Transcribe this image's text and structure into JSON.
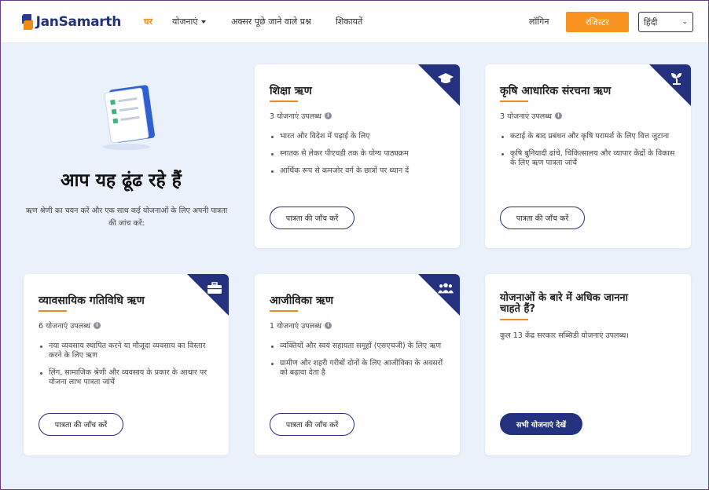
{
  "header": {
    "logo_text": "JanSamarth",
    "nav": [
      {
        "label": "घर",
        "active": true
      },
      {
        "label": "योजनाएं",
        "has_caret": true
      },
      {
        "label": "अक्सर पूछे जाने वाले प्रश्न"
      },
      {
        "label": "शिकायतें"
      }
    ],
    "login_label": "लॉगिन",
    "register_label": "रजिस्टर",
    "language": "हिंदी",
    "accent_color": "#f7931e",
    "brand_color": "#24317e"
  },
  "intro": {
    "title": "आप यह ढूंढ रहे हैं",
    "subtitle": "ऋण श्रेणी का चयन करें और एक साथ कई योजनाओं के लिए अपनी पात्रता की जांच करें:"
  },
  "cards": [
    {
      "title": "शिक्षा ऋण",
      "count": "3 योजनाएं उपलब्ध",
      "icon": "graduation-cap-icon",
      "bullets": [
        "भारत और विदेश में पढ़ाई के लिए",
        "स्नातक से लेकर पीएचडी तक के योग्य पाठ्यक्रम",
        "आर्थिक रूप से कमजोर वर्ग के छात्रों पर ध्यान दें"
      ],
      "button": "पात्रता की जाँच करें"
    },
    {
      "title": "कृषि आधारिक संरचना ऋण",
      "count": "3 योजनाएं उपलब्ध",
      "icon": "sprout-icon",
      "bullets": [
        "कटाई के बाद प्रबंधन और कृषि परामर्श के लिए वित्त जुटाना",
        "कृषि बुनियादी ढांचे, चिकित्सालय और व्यापार केंद्रों के विकास के लिए ऋण पात्रता जांचें"
      ],
      "button": "पात्रता की जाँच करें"
    },
    {
      "title": "व्यावसायिक गतिविधि ऋण",
      "count": "6 योजनाएं उपलब्ध",
      "icon": "briefcase-icon",
      "bullets": [
        "नया व्यवसाय स्थापित करने या मौजूदा व्यवसाय का विस्तार करने के लिए ऋण",
        "लिंग, सामाजिक श्रेणी और व्यवसाय के प्रकार के आधार पर योजना लाभ पात्रता जांचें"
      ],
      "button": "पात्रता की जाँच करें"
    },
    {
      "title": "आजीविका ऋण",
      "count": "1 योजनाएं उपलब्ध",
      "icon": "people-icon",
      "bullets": [
        "व्यक्तियों और स्वयं सहायता समूहों (एसएचजी) के लिए ऋण",
        "ग्रामीण और शहरी गरीबों दोनों के लिए आजीविका के अवसरों को बढ़ावा देता है"
      ],
      "button": "पात्रता की जाँच करें"
    }
  ],
  "more": {
    "title": "योजनाओं के बारे में अधिक जानना चाहते हैं?",
    "subtitle": "कुल 13 केंद्र सरकार सब्सिडी योजनाएं उपलब्ध।",
    "button": "सभी योजनाएं देखें"
  }
}
